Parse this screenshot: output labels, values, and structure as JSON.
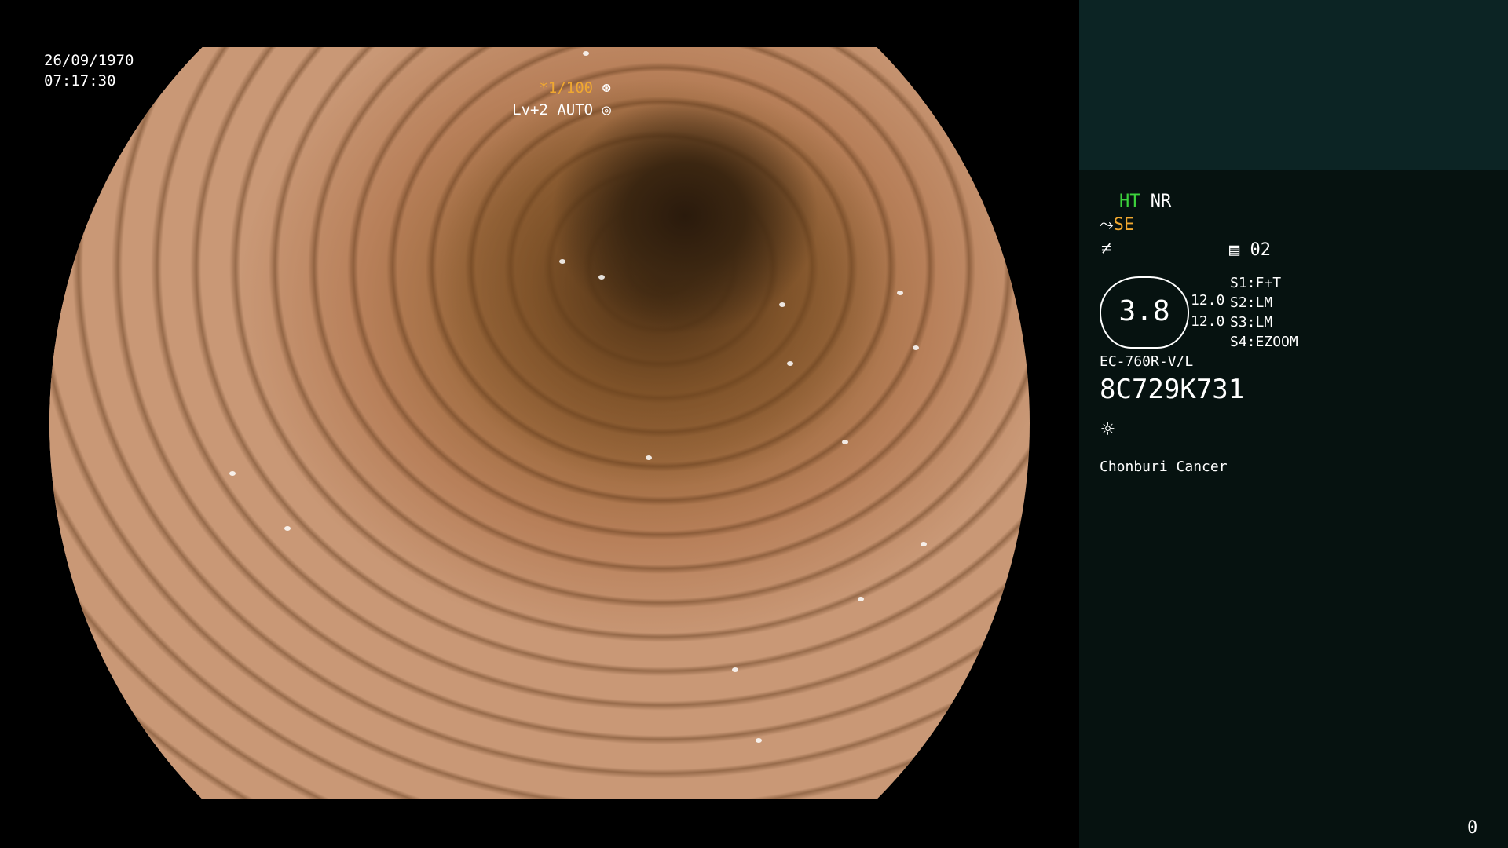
{
  "overlay": {
    "date": "26/09/1970",
    "time": "07:17:30",
    "shutter": "*1/100",
    "shutter_icon": "shutter-icon",
    "iris": "Lv+2 AUTO",
    "iris_icon": "iris-icon"
  },
  "panel": {
    "ht": "HT",
    "nr": "NR",
    "se": "SE",
    "record_icon": "memory-icon",
    "record_num": "02",
    "zoom_value": "3.8",
    "values": [
      "12.0",
      "12.0"
    ],
    "switches": [
      {
        "key": "S1:",
        "value": "F+T"
      },
      {
        "key": "S2:",
        "value": "LM"
      },
      {
        "key": "S3:",
        "value": "LM"
      },
      {
        "key": "S4:",
        "value": "EZOOM"
      }
    ],
    "scope_model": "EC-760R-V/L",
    "scope_serial": "8C729K731",
    "light_icon": "light-icon",
    "facility": "Chonburi Cancer",
    "counter": "0"
  },
  "colors": {
    "accent_green": "#3cd23c",
    "accent_orange": "#f0a830",
    "panel_bg": "#061210",
    "panel_top_bg": "#0c2424"
  }
}
